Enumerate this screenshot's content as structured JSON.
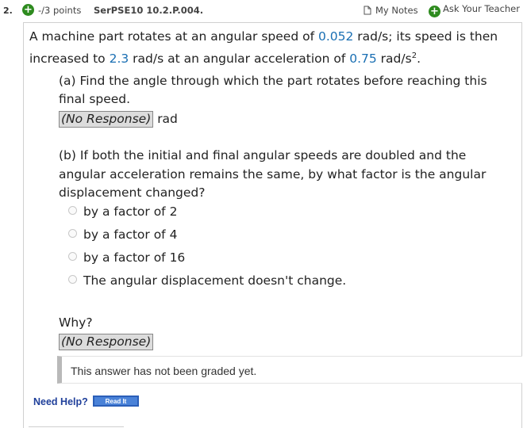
{
  "header": {
    "question_number": "2.",
    "points": "-/3 points",
    "problem_code": "SerPSE10 10.2.P.004.",
    "my_notes_label": "My Notes",
    "ask_teacher_label": "Ask Your Teacher"
  },
  "question": {
    "line1_pre": "A machine part rotates at an angular speed of ",
    "initial_speed": "0.052",
    "line1_post": " rad/s; its speed is then",
    "line2_pre": "increased to ",
    "final_speed": "2.3",
    "line2_mid": " rad/s at an angular acceleration of ",
    "acceleration": "0.75",
    "line2_unit": " rad/s",
    "line2_exp": "2",
    "line2_end": "."
  },
  "part_a": {
    "line1": "(a) Find the angle through which the part rotates before reaching this",
    "line2": "final speed.",
    "response": "(No Response)",
    "unit": "rad"
  },
  "part_b": {
    "line1": "(b) If both the initial and final angular speeds are doubled and the",
    "line2": "angular acceleration remains the same, by what factor is the angular",
    "line3": "displacement changed?",
    "options": [
      "by a factor of 2",
      "by a factor of 4",
      "by a factor of 16",
      "The angular displacement doesn't change."
    ],
    "why_label": "Why?",
    "why_response": "(No Response)"
  },
  "grading_note": "This answer has not been graded yet.",
  "help": {
    "need_help_label": "Need Help?",
    "read_it_label": "Read It"
  },
  "colors": {
    "accent_green": "#2e8b1f",
    "value_blue": "#1a6fb3",
    "help_blue": "#1f3f9a"
  }
}
